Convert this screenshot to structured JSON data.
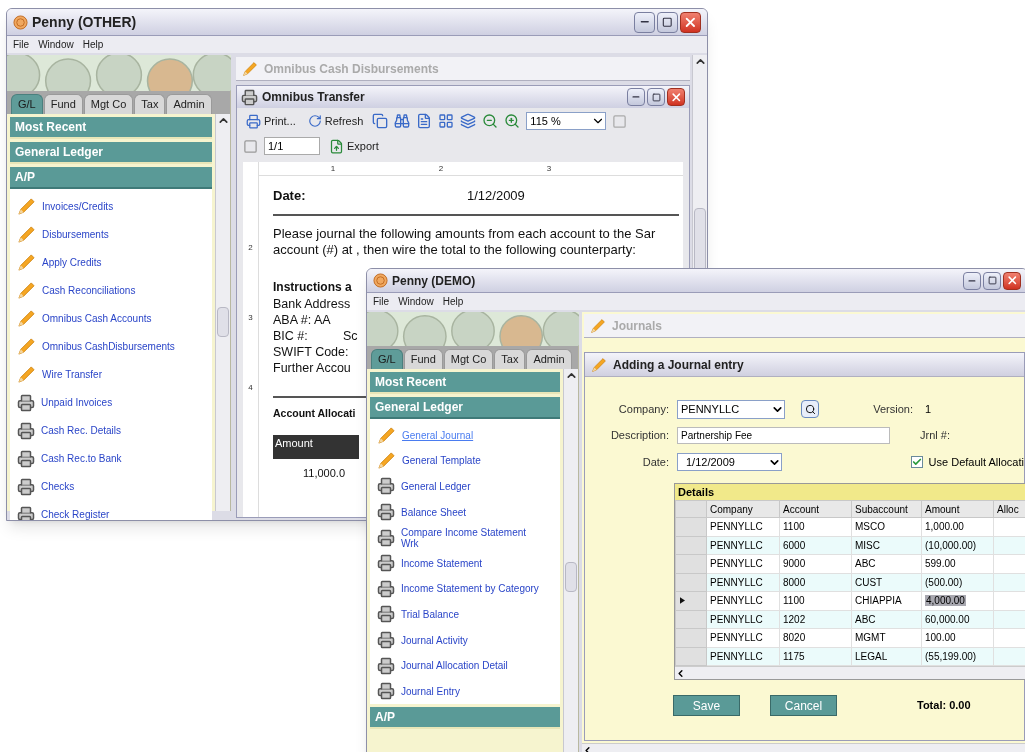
{
  "back_window": {
    "title": "Penny (OTHER)",
    "menu": [
      "File",
      "Window",
      "Help"
    ],
    "nav_tabs": [
      {
        "label": "G/L",
        "selected": true
      },
      {
        "label": "Fund",
        "selected": false
      },
      {
        "label": "Mgt Co",
        "selected": false
      },
      {
        "label": "Tax",
        "selected": false
      },
      {
        "label": "Admin",
        "selected": false
      }
    ],
    "sections": [
      {
        "label": "Most Recent",
        "expanded": false
      },
      {
        "label": "General Ledger",
        "expanded": false
      },
      {
        "label": "A/P",
        "expanded": true,
        "items": [
          {
            "label": "Invoices/Credits",
            "kind": "form",
            "selected": false
          },
          {
            "label": "Disbursements",
            "kind": "form",
            "selected": false
          },
          {
            "label": "Apply Credits",
            "kind": "form",
            "selected": false
          },
          {
            "label": "Cash Reconciliations",
            "kind": "form",
            "selected": false
          },
          {
            "label": "Omnibus Cash Accounts",
            "kind": "form",
            "selected": false
          },
          {
            "label": "Omnibus CashDisbursements",
            "kind": "form",
            "selected": false
          },
          {
            "label": "Wire Transfer",
            "kind": "form",
            "selected": false
          },
          {
            "label": "Unpaid Invoices",
            "kind": "report",
            "selected": false
          },
          {
            "label": "Cash Rec. Details",
            "kind": "report",
            "selected": false
          },
          {
            "label": "Cash Rec.to Bank",
            "kind": "report",
            "selected": false
          },
          {
            "label": "Checks",
            "kind": "report",
            "selected": false
          },
          {
            "label": "Check Register",
            "kind": "report",
            "selected": false
          }
        ]
      }
    ],
    "inactive_child": {
      "title": "Omnibus Cash Disbursements"
    },
    "report": {
      "title": "Omnibus Transfer",
      "print": "Print...",
      "refresh": "Refresh",
      "zoom": "115 %",
      "page": "1/1",
      "export": "Export",
      "ruler_labels": [
        "1",
        "2",
        "3"
      ],
      "side_ruler_labels": [
        "2",
        "3",
        "4"
      ],
      "date_label": "Date:",
      "date_value": "1/12/2009",
      "paragraph": [
        "Please journal the following amounts from each account to the Sar",
        "account (#) at , then wire the total to the following counterparty:"
      ],
      "instructions_heading": "Instructions a",
      "instructions": [
        {
          "label": "Bank Address"
        },
        {
          "label": "ABA #: AA"
        },
        {
          "label": "BIC #:",
          "value": "Sc"
        },
        {
          "label": "SWIFT Code:"
        },
        {
          "label": "Further Accou"
        }
      ],
      "allocation_heading": "Account Allocati",
      "allocation_column": "Amount",
      "allocation_values": [
        "11,000.0"
      ]
    }
  },
  "front_window": {
    "title": "Penny (DEMO)",
    "menu": [
      "File",
      "Window",
      "Help"
    ],
    "nav_tabs": [
      {
        "label": "G/L",
        "selected": true
      },
      {
        "label": "Fund",
        "selected": false
      },
      {
        "label": "Mgt Co",
        "selected": false
      },
      {
        "label": "Tax",
        "selected": false
      },
      {
        "label": "Admin",
        "selected": false
      }
    ],
    "sections": [
      {
        "label": "Most Recent",
        "expanded": false
      },
      {
        "label": "General Ledger",
        "expanded": true,
        "items": [
          {
            "label": "General Journal",
            "kind": "form",
            "selected": true
          },
          {
            "label": "General Template",
            "kind": "form",
            "selected": false
          },
          {
            "label": "General Ledger",
            "kind": "report",
            "selected": false
          },
          {
            "label": "Balance Sheet",
            "kind": "report",
            "selected": false
          },
          {
            "label": "Compare Income Statement",
            "label_2": "Wrk",
            "kind": "report",
            "selected": false
          },
          {
            "label": "Income Statement",
            "kind": "report",
            "selected": false
          },
          {
            "label": "Income Statement by Category",
            "kind": "report",
            "selected": false
          },
          {
            "label": "Trial Balance",
            "kind": "report",
            "selected": false
          },
          {
            "label": "Journal Activity",
            "kind": "report",
            "selected": false
          },
          {
            "label": "Journal Allocation Detail",
            "kind": "report",
            "selected": false
          },
          {
            "label": "Journal Entry",
            "kind": "report",
            "selected": false
          }
        ]
      },
      {
        "label": "A/P",
        "expanded": false
      }
    ],
    "inactive_child": {
      "title": "Journals"
    },
    "form": {
      "title": "Adding a Journal entry",
      "company_label": "Company:",
      "company": "PENNYLLC",
      "version_label": "Version:",
      "version": "1",
      "description_label": "Description:",
      "description": "Partnership Fee",
      "jrnl_label": "Jrnl #:",
      "date_label": "Date:",
      "date": "1/12/2009",
      "default_allocation": {
        "label": "Use Default Allocati",
        "checked": true
      },
      "details": {
        "title": "Details",
        "columns": [
          "Company",
          "Account",
          "Subaccount",
          "Amount",
          "Alloc"
        ],
        "rows": [
          {
            "cells": [
              "PENNYLLC",
              "1100",
              "MSCO",
              "1,000.00"
            ],
            "current": false
          },
          {
            "cells": [
              "PENNYLLC",
              "6000",
              "MISC",
              "(10,000.00)"
            ],
            "current": false
          },
          {
            "cells": [
              "PENNYLLC",
              "9000",
              "ABC",
              "599.00"
            ],
            "current": false
          },
          {
            "cells": [
              "PENNYLLC",
              "8000",
              "CUST",
              "(500.00)"
            ],
            "current": false
          },
          {
            "cells": [
              "PENNYLLC",
              "1100",
              "CHIAPPIA",
              "4,000.00"
            ],
            "current": true
          },
          {
            "cells": [
              "PENNYLLC",
              "1202",
              "ABC",
              "60,000.00"
            ],
            "current": false
          },
          {
            "cells": [
              "PENNYLLC",
              "8020",
              "MGMT",
              "100.00"
            ],
            "current": false
          },
          {
            "cells": [
              "PENNYLLC",
              "1175",
              "LEGAL",
              "(55,199.00)"
            ],
            "current": false
          }
        ]
      },
      "buttons": [
        "Save",
        "Cancel"
      ],
      "total": "Total: 0.00"
    }
  }
}
